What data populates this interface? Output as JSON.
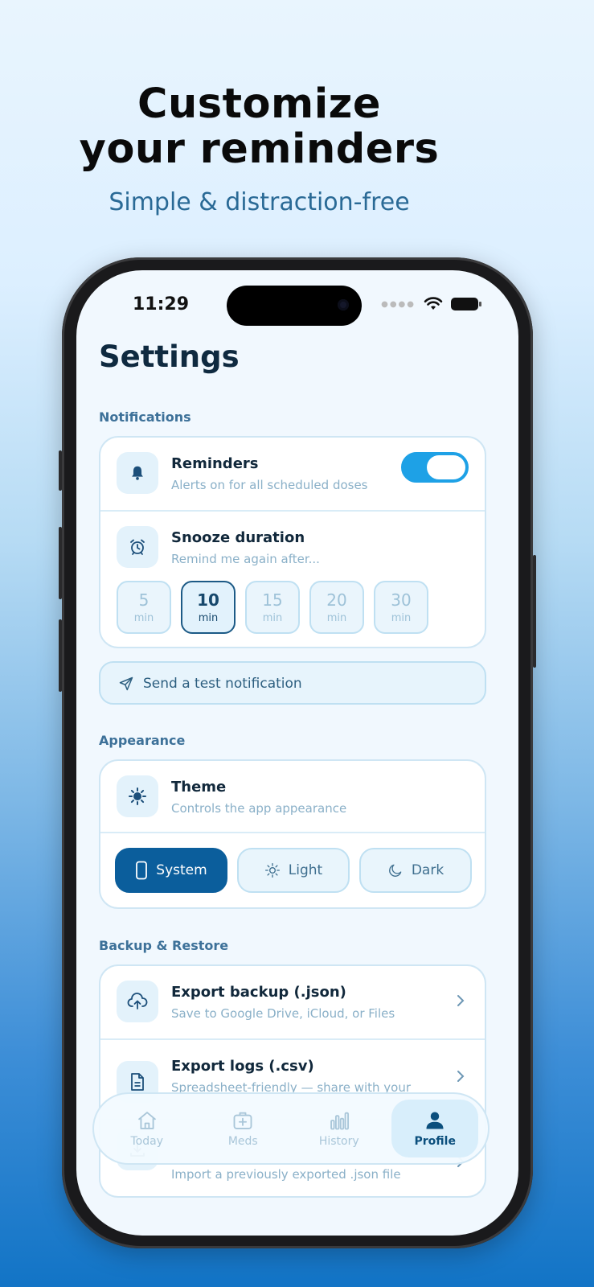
{
  "promo": {
    "headline_line1": "Customize",
    "headline_line2": "your reminders",
    "subheadline": "Simple & distraction-free"
  },
  "status_bar": {
    "time": "11:29"
  },
  "page": {
    "title": "Settings"
  },
  "notifications": {
    "section_label": "Notifications",
    "reminders": {
      "title": "Reminders",
      "subtitle": "Alerts on for all scheduled doses",
      "enabled": true
    },
    "snooze": {
      "title": "Snooze duration",
      "subtitle": "Remind me again after...",
      "options": [
        {
          "value": "5",
          "unit": "min"
        },
        {
          "value": "10",
          "unit": "min"
        },
        {
          "value": "15",
          "unit": "min"
        },
        {
          "value": "20",
          "unit": "min"
        },
        {
          "value": "30",
          "unit": "min"
        }
      ],
      "selected": "10"
    },
    "test_button_label": "Send a test notification"
  },
  "appearance": {
    "section_label": "Appearance",
    "theme": {
      "title": "Theme",
      "subtitle": "Controls the app appearance"
    },
    "options": [
      {
        "label": "System",
        "icon": "phone-icon"
      },
      {
        "label": "Light",
        "icon": "sun-icon"
      },
      {
        "label": "Dark",
        "icon": "moon-icon"
      }
    ],
    "selected": "System"
  },
  "backup": {
    "section_label": "Backup & Restore",
    "items": [
      {
        "title": "Export backup (.json)",
        "subtitle": "Save to Google Drive, iCloud, or Files",
        "icon": "cloud-upload-icon"
      },
      {
        "title": "Export logs (.csv)",
        "subtitle": "Spreadsheet-friendly — share with your",
        "icon": "document-icon"
      },
      {
        "title": "",
        "subtitle": "Import a previously exported .json file",
        "icon": "download-icon"
      }
    ]
  },
  "tabbar": {
    "tabs": [
      {
        "label": "Today",
        "icon": "home-icon"
      },
      {
        "label": "Meds",
        "icon": "medkit-icon"
      },
      {
        "label": "History",
        "icon": "bar-chart-icon"
      },
      {
        "label": "Profile",
        "icon": "person-icon"
      }
    ],
    "selected": "Profile"
  },
  "colors": {
    "accent": "#0b5e9c",
    "toggle_on": "#1ea1e6",
    "text_dark": "#11283b",
    "section_label": "#3d7199"
  }
}
